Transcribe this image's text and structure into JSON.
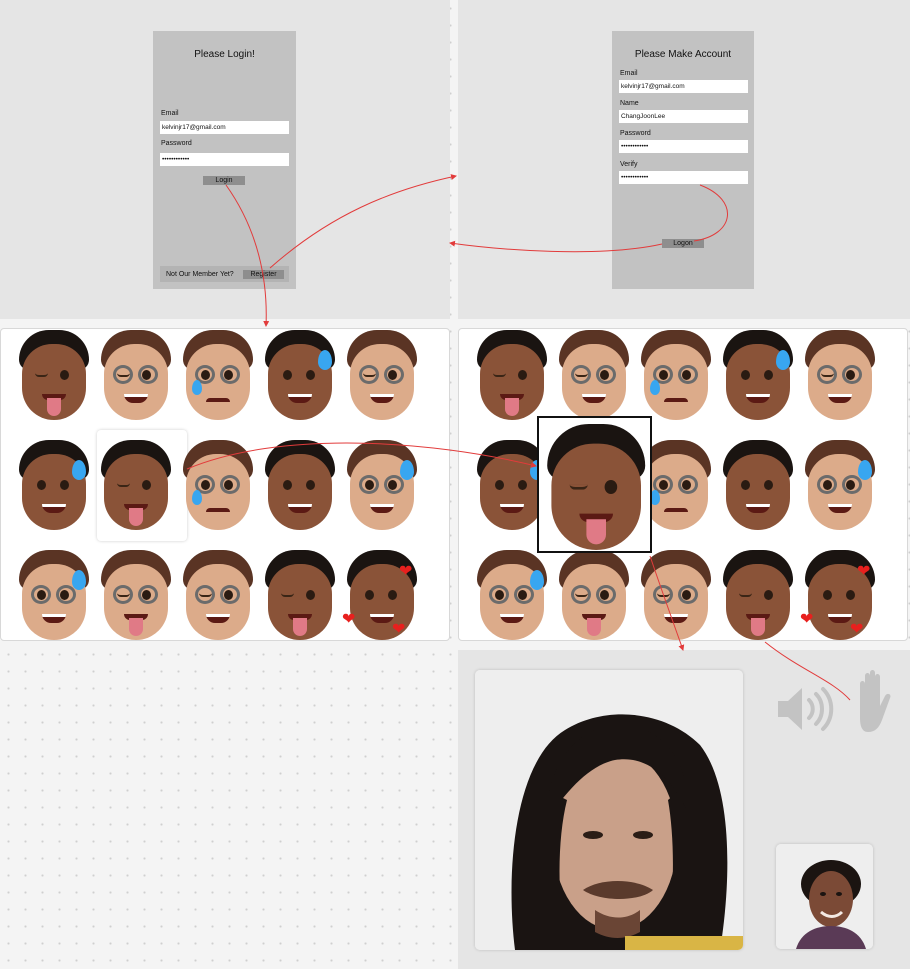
{
  "login": {
    "title": "Please Login!",
    "email_label": "Email",
    "email_value": "kelvinjr17@gmail.com",
    "password_label": "Password",
    "password_value": "••••••••••••",
    "login_button": "Login",
    "footer_text": "Not Our Member Yet?",
    "register_button": "Register"
  },
  "signup": {
    "title": "Please Make Account",
    "email_label": "Email",
    "email_value": "kelvinjr17@gmail.com",
    "name_label": "Name",
    "name_value": "ChangJoonLee",
    "password_label": "Password",
    "password_value": "••••••••••••",
    "verify_label": "Verify",
    "verify_value": "••••••••••••",
    "logon_button": "Logon"
  },
  "emoji_grid": {
    "left": [
      "wink-tongue-dark",
      "wink-glasses-light",
      "crying-glasses-light",
      "sweat-dark",
      "wink-glasses-light",
      "sweat-dark",
      "wink-tongue-dark",
      "crying-glasses-light",
      "smile-dark",
      "sweat-glasses-light",
      "sweat-glasses-light",
      "wink-tongue-glasses-light",
      "wink-glasses-light",
      "wink-tongue-dark",
      "hearts-dark"
    ],
    "right": [
      "wink-tongue-dark",
      "wink-glasses-light",
      "crying-glasses-light",
      "sweat-dark",
      "wink-glasses-light",
      "sweat-dark",
      "wink-tongue-dark",
      "crying-glasses-light",
      "smile-dark",
      "sweat-glasses-light",
      "sweat-glasses-light",
      "wink-tongue-glasses-light",
      "wink-glasses-light",
      "wink-tongue-dark",
      "hearts-dark"
    ],
    "selected_emoji": "wink-tongue-dark"
  },
  "call": {
    "speaker_icon": "speaker-icon",
    "hand_icon": "raised-hand-icon"
  },
  "colors": {
    "frame_bg": "#e5e5e5",
    "phone_bg": "#c2c2c2",
    "button_bg": "#8e8e8e",
    "arrow": "#e23b3b"
  }
}
